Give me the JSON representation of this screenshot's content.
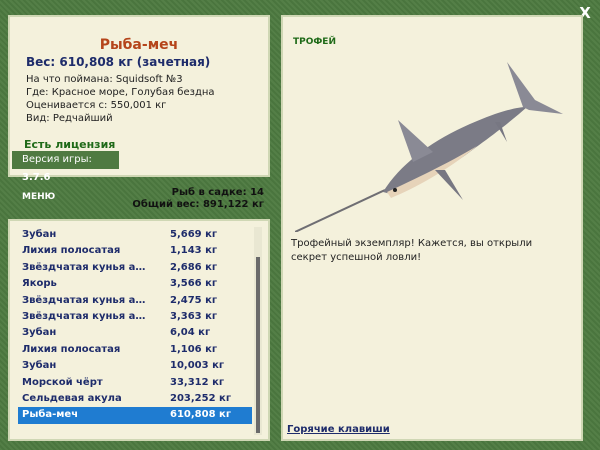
{
  "window": {
    "close_label": "X"
  },
  "fish": {
    "name": "Рыба-меч",
    "weight": "Вес: 610,808 кг (зачетная)",
    "caught_with": "На что поймана: Squidsoft №3",
    "location": "Где: Красное море, Голубая бездна",
    "value": "Оценивается с: 550,001 кг",
    "kind": "Вид: Редчайший"
  },
  "license": "Есть лицензия",
  "version": {
    "label": "Версия игры:",
    "value": "3.7.6"
  },
  "menu_label": "МЕНЮ",
  "keepnet": {
    "count": "Рыб в садке: 14",
    "total": "Общий вес: 891,122 кг"
  },
  "catch_list": [
    {
      "name": "Зубан",
      "weight": "5,669 кг"
    },
    {
      "name": "Лихия полосатая",
      "weight": "1,143 кг"
    },
    {
      "name": "Звёздчатая кунья аку...",
      "weight": "2,686 кг"
    },
    {
      "name": "Якорь",
      "weight": "3,566 кг"
    },
    {
      "name": "Звёздчатая кунья аку...",
      "weight": "2,475 кг"
    },
    {
      "name": "Звёздчатая кунья аку...",
      "weight": "3,363 кг"
    },
    {
      "name": "Зубан",
      "weight": "6,04 кг"
    },
    {
      "name": "Лихия полосатая",
      "weight": "1,106 кг"
    },
    {
      "name": "Зубан",
      "weight": "10,003 кг"
    },
    {
      "name": "Морской чёрт",
      "weight": "33,312 кг"
    },
    {
      "name": "Сельдевая акула",
      "weight": "203,252 кг"
    },
    {
      "name": "Рыба-меч",
      "weight": "610,808 кг"
    }
  ],
  "selected_index": 11,
  "trophy": {
    "label": "ТРОФЕЙ",
    "text": "Трофейный экземпляр! Кажется, вы открыли секрет успешной ловли!"
  },
  "hotkeys_label": "Горячие клавиши"
}
